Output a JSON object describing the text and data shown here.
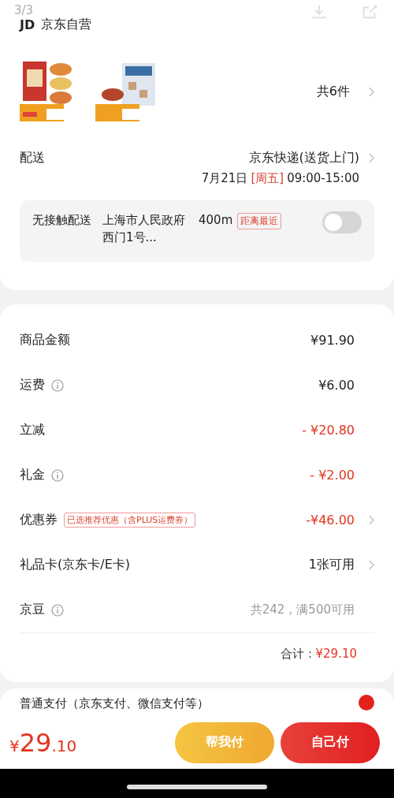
{
  "viewer": {
    "page": "3/3"
  },
  "store": {
    "logo": "JD",
    "name": "京东自营"
  },
  "item_count": "共6件",
  "delivery": {
    "label": "配送",
    "method": "京东快递(送货上门)",
    "date": "7月21日",
    "weekday": "[周五]",
    "time": "09:00-15:00"
  },
  "contactless": {
    "label": "无接触配送",
    "address": "上海市人民政府西门1号...",
    "distance": "400m",
    "tag": "距离最近",
    "on": false
  },
  "fees": [
    {
      "label": "商品金额",
      "info": false,
      "value": "¥91.90",
      "kind": "amount",
      "chevron": false
    },
    {
      "label": "运费",
      "info": true,
      "value": "¥6.00",
      "kind": "amount",
      "chevron": false
    },
    {
      "label": "立减",
      "info": false,
      "value": "- ¥20.80",
      "kind": "discount",
      "chevron": false
    },
    {
      "label": "礼金",
      "info": true,
      "value": "- ¥2.00",
      "kind": "discount",
      "chevron": false
    },
    {
      "label": "优惠券",
      "info": false,
      "tag": "已选推荐优惠（含PLUS运费券）",
      "value": "-¥46.00",
      "kind": "discount",
      "chevron": true
    },
    {
      "label": "礼品卡(京东卡/E卡)",
      "info": false,
      "value": "1张可用",
      "kind": "amount",
      "chevron": true
    },
    {
      "label": "京豆",
      "info": true,
      "value": "共242，满500可用",
      "kind": "muted",
      "chevron": false
    }
  ],
  "total": {
    "label": "合计：",
    "value": "¥29.10"
  },
  "payment": {
    "label": "普通支付（京东支付、微信支付等）"
  },
  "bottom_bar": {
    "currency": "¥",
    "integer": "29",
    "decimal": ".10",
    "buttons": [
      {
        "label": "帮我付",
        "kind": "help"
      },
      {
        "label": "自己付",
        "kind": "self"
      }
    ]
  }
}
